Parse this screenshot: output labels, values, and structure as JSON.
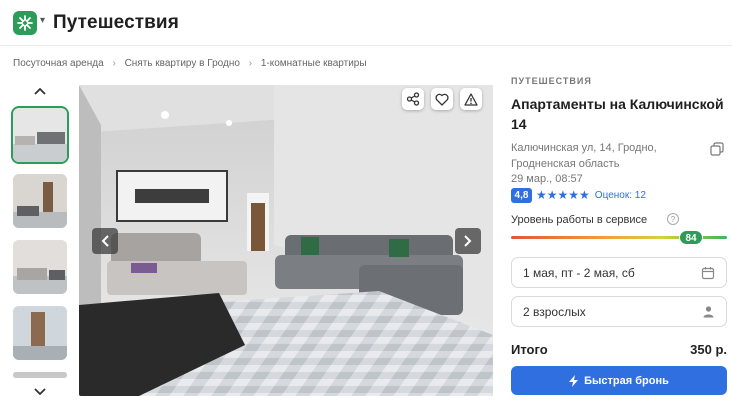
{
  "header": {
    "brand": "Путешествия",
    "logo_icon": "snowflake-logo-icon",
    "brand_color": "#2e9b5a"
  },
  "breadcrumbs": [
    {
      "label": "Посуточная аренда"
    },
    {
      "label": "Снять квартиру в Гродно"
    },
    {
      "label": "1-комнатные квартиры"
    }
  ],
  "gallery": {
    "up_icon": "chevron-up-icon",
    "down_icon": "chevron-down-icon",
    "thumbnails_count": 5,
    "active_index": 0,
    "prev_icon": "chevron-left-icon",
    "next_icon": "chevron-right-icon",
    "actions": [
      {
        "icon": "share-icon"
      },
      {
        "icon": "heart-icon"
      },
      {
        "icon": "warning-icon"
      }
    ]
  },
  "listing": {
    "category": "ПУТЕШЕСТВИЯ",
    "title": "Апартаменты на Калючинской 14",
    "address": "Калючинская ул, 14, Гродно, Гродненская область",
    "date": "29 мар., 08:57",
    "copy_icon": "copy-icon",
    "rating": "4,8",
    "stars": "★★★★★",
    "reviews": "Оценок: 12",
    "service_label": "Уровень работы в сервисе",
    "service_score": "84",
    "service_level_percent": 84,
    "accent_color": "#2f6fe0"
  },
  "booking": {
    "dates": "1 мая, пт - 2 мая, сб",
    "dates_icon": "calendar-icon",
    "guests": "2 взрослых",
    "guests_icon": "person-icon",
    "total_label": "Итого",
    "total_value": "350 р.",
    "button_label": "Быстрая бронь",
    "button_icon": "lightning-icon"
  }
}
